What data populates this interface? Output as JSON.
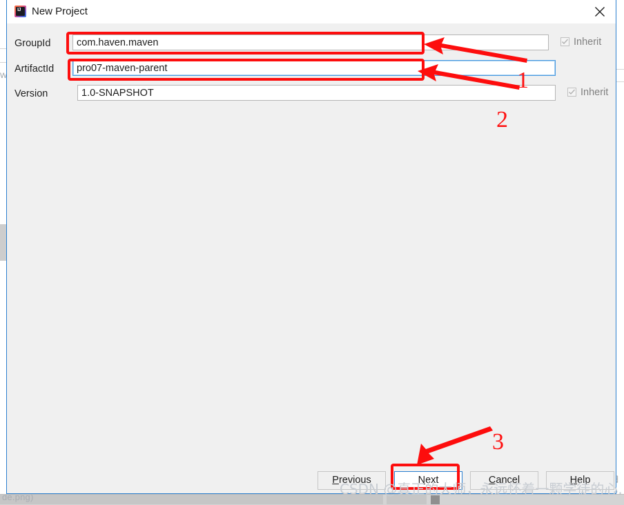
{
  "window": {
    "title": "New Project",
    "app_icon": "intellij-idea-icon",
    "close_icon": "close-icon",
    "border_color": "#2a7fcf"
  },
  "form": {
    "rows": [
      {
        "label": "GroupId",
        "value": "com.haven.maven",
        "inherit_label": "Inherit",
        "inherit_checked": true,
        "inherit_enabled": false,
        "focused": false
      },
      {
        "label": "ArtifactId",
        "value": "pro07-maven-parent",
        "inherit_label": "",
        "inherit_checked": false,
        "inherit_enabled": false,
        "focused": true
      },
      {
        "label": "Version",
        "value": "1.0-SNAPSHOT",
        "inherit_label": "Inherit",
        "inherit_checked": true,
        "inherit_enabled": false,
        "focused": false
      }
    ]
  },
  "buttons": {
    "previous": {
      "label": "Previous",
      "mnemonic": "P",
      "default": false
    },
    "next": {
      "label": "Next",
      "mnemonic": "N",
      "default": true
    },
    "cancel": {
      "label": "Cancel",
      "mnemonic": "C",
      "default": false
    },
    "help": {
      "label": "Help",
      "mnemonic": "H",
      "default": false
    }
  },
  "annotations": {
    "color": "#fd0d0d",
    "markers": [
      {
        "number": "1",
        "target": "groupid-field"
      },
      {
        "number": "2",
        "target": "artifactid-field"
      },
      {
        "number": "3",
        "target": "next-button"
      }
    ]
  },
  "watermark": {
    "text": "CSDN @真正的大师，永远怀着一颗学徒的心."
  },
  "background": {
    "taskbar_text": "de.png)",
    "left_glyph": "W"
  }
}
